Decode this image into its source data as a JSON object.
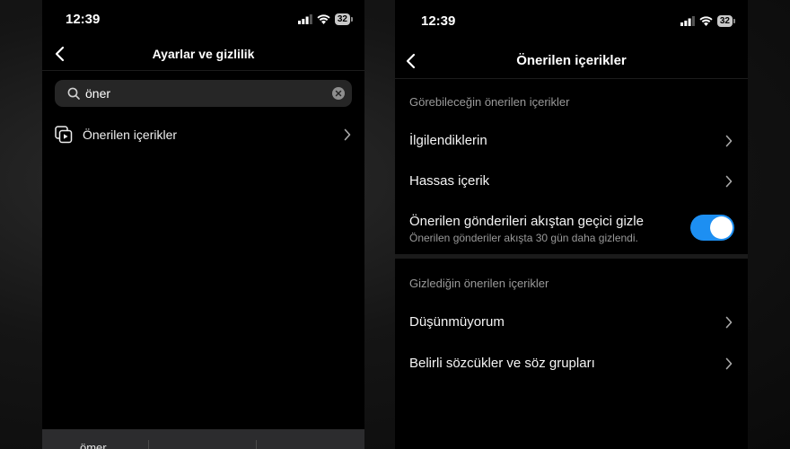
{
  "left_phone": {
    "status": {
      "time": "12:39",
      "battery": "32"
    },
    "nav": {
      "title": "Ayarlar ve gizlilik"
    },
    "search": {
      "value": "öner"
    },
    "results": [
      {
        "label": "Önerilen içerikler",
        "icon": "suggested-content-icon"
      }
    ],
    "keyboard": {
      "suggestions": [
        "ömer"
      ]
    }
  },
  "right_phone": {
    "status": {
      "time": "12:39",
      "battery": "32"
    },
    "nav": {
      "title": "Önerilen içerikler"
    },
    "section1": {
      "header": "Görebileceğin önerilen içerikler",
      "rows": [
        {
          "label": "İlgilendiklerin"
        },
        {
          "label": "Hassas içerik"
        }
      ],
      "toggle": {
        "label": "Önerilen gönderileri akıştan geçici gizle",
        "sublabel": "Önerilen gönderiler akışta 30 gün daha gizlendi.",
        "state": "on"
      }
    },
    "section2": {
      "header": "Gizlediğin önerilen içerikler",
      "rows": [
        {
          "label": "Düşünmüyorum"
        },
        {
          "label": "Belirli sözcükler ve söz grupları"
        }
      ]
    }
  },
  "colors": {
    "accent": "#1d8ff2",
    "background": "#000000",
    "secondary_text": "#9a9a9a"
  }
}
